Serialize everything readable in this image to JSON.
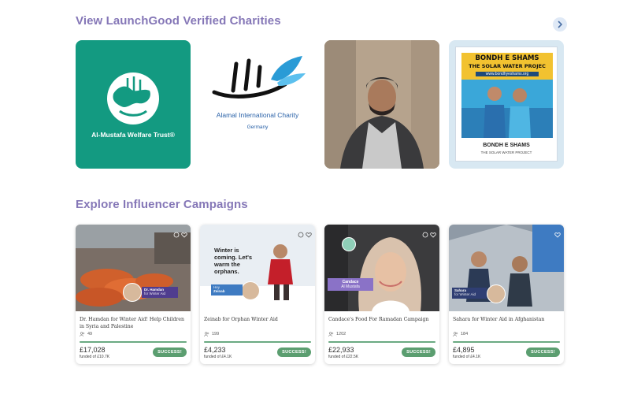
{
  "sections": {
    "charities_title": "View LaunchGood Verified Charities",
    "influencers_title": "Explore Influencer Campaigns"
  },
  "charities": [
    {
      "name": "Al-Mustafa Welfare Trust®"
    },
    {
      "name": "Alamal International Charity",
      "sub": "Germany"
    },
    {
      "name": ""
    },
    {
      "poster_title": "BONDH E SHAMS",
      "poster_sub": "THE SOLAR WATER PROJEC",
      "poster_url": "www.bondhyeshams.org",
      "logo": "BONDH E SHAMS",
      "logo_sub": "THE SOLAR WATER PROJECT"
    }
  ],
  "campaigns": [
    {
      "title": "Dr. Hamdan for Winter Aid! Help Children in Syria and Palestine",
      "supporters": "49",
      "raised": "£17,028",
      "goal": "funded of £10.7K",
      "status": "SUCCESS!",
      "progress": 1.0,
      "tag_name": "Dr. Hamdan",
      "tag_sub": "for Winter Aid"
    },
    {
      "title": "Zeinab for Orphan Winter Aid",
      "supporters": "199",
      "raised": "£4,233",
      "goal": "funded of £4.1K",
      "status": "SUCCESS!",
      "progress": 1.0,
      "poster_text": "Winter is coming. Let's warm the orphans.",
      "tag_name": "Zeinab",
      "tag_sub": "Hey"
    },
    {
      "title": "Candace's Food For Ramadan Campaign",
      "supporters": "1202",
      "raised": "£22,933",
      "goal": "funded of £22.5K",
      "status": "SUCCESS!",
      "progress": 1.0,
      "tag_name": "Candace",
      "tag_sub": "Al Mustafa"
    },
    {
      "title": "Sahara for Winter Aid in Afghanistan",
      "supporters": "184",
      "raised": "£4,895",
      "goal": "funded of £4.1K",
      "status": "SUCCESS!",
      "progress": 1.0,
      "tag_name": "Sahara",
      "tag_sub": "for Winter Aid"
    }
  ],
  "colors": {
    "accent": "#8577b7",
    "success": "#5b9e70",
    "teal": "#139a81"
  }
}
